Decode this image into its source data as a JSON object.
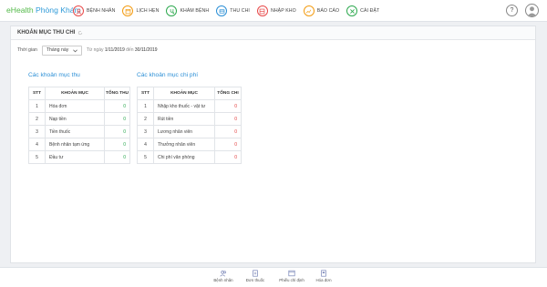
{
  "brand": {
    "part1": "eHealth",
    "part2": " Phòng Khám"
  },
  "nav": [
    {
      "label": "BỆNH NHÂN",
      "color": "#e84a4a",
      "icon": "patient-icon"
    },
    {
      "label": "LỊCH HẸN",
      "color": "#f39c12",
      "icon": "calendar-icon"
    },
    {
      "label": "KHÁM BỆNH",
      "color": "#2ea94f",
      "icon": "stethoscope-icon"
    },
    {
      "label": "THU CHI",
      "color": "#2b8fd6",
      "icon": "wallet-icon"
    },
    {
      "label": "NHẬP KHO",
      "color": "#e84a4a",
      "icon": "warehouse-icon"
    },
    {
      "label": "BÁO CÁO",
      "color": "#f39c12",
      "icon": "report-icon"
    },
    {
      "label": "CÀI ĐẶT",
      "color": "#2ea94f",
      "icon": "settings-icon"
    }
  ],
  "help": {
    "label": "?"
  },
  "panel": {
    "title": "KHOẢN MỤC THU CHI",
    "filter_label": "Thời gian",
    "filter_value": "Tháng này",
    "range_prefix": "Từ ngày",
    "range_from": "1/11/2019",
    "range_mid": "đến",
    "range_to": "30/11/2019"
  },
  "income": {
    "title": "Các khoản mục thu",
    "headers": {
      "stt": "STT",
      "name": "KHOẢN MỤC",
      "total": "TỔNG THU"
    },
    "rows": [
      {
        "stt": "1",
        "name": "Hóa đơn",
        "total": "0"
      },
      {
        "stt": "2",
        "name": "Nạp tiền",
        "total": "0"
      },
      {
        "stt": "3",
        "name": "Tiền thuốc",
        "total": "0"
      },
      {
        "stt": "4",
        "name": "Bệnh nhân tạm ứng",
        "total": "0"
      },
      {
        "stt": "5",
        "name": "Đầu tư",
        "total": "0"
      }
    ]
  },
  "expense": {
    "title": "Các khoản mục chi phí",
    "headers": {
      "stt": "STT",
      "name": "KHOẢN MỤC",
      "total": "TỔNG CHI"
    },
    "rows": [
      {
        "stt": "1",
        "name": "Nhập kho thuốc - vật tư",
        "total": "0"
      },
      {
        "stt": "2",
        "name": "Rút tiền",
        "total": "0"
      },
      {
        "stt": "3",
        "name": "Lương nhân viên",
        "total": "0"
      },
      {
        "stt": "4",
        "name": "Thưởng nhân viên",
        "total": "0"
      },
      {
        "stt": "5",
        "name": "Chi phí văn phòng",
        "total": "0"
      }
    ]
  },
  "bottom": [
    {
      "label": "Bệnh nhân",
      "icon": "patients-icon"
    },
    {
      "label": "Đơn thuốc",
      "icon": "prescription-icon"
    },
    {
      "label": "Phiếu chỉ định",
      "icon": "order-form-icon"
    },
    {
      "label": "Hóa đơn",
      "icon": "invoice-icon"
    }
  ],
  "colors": {
    "accent": "#2b8fd6",
    "income_value": "#2aa84f",
    "expense_value": "#e23b3b"
  }
}
